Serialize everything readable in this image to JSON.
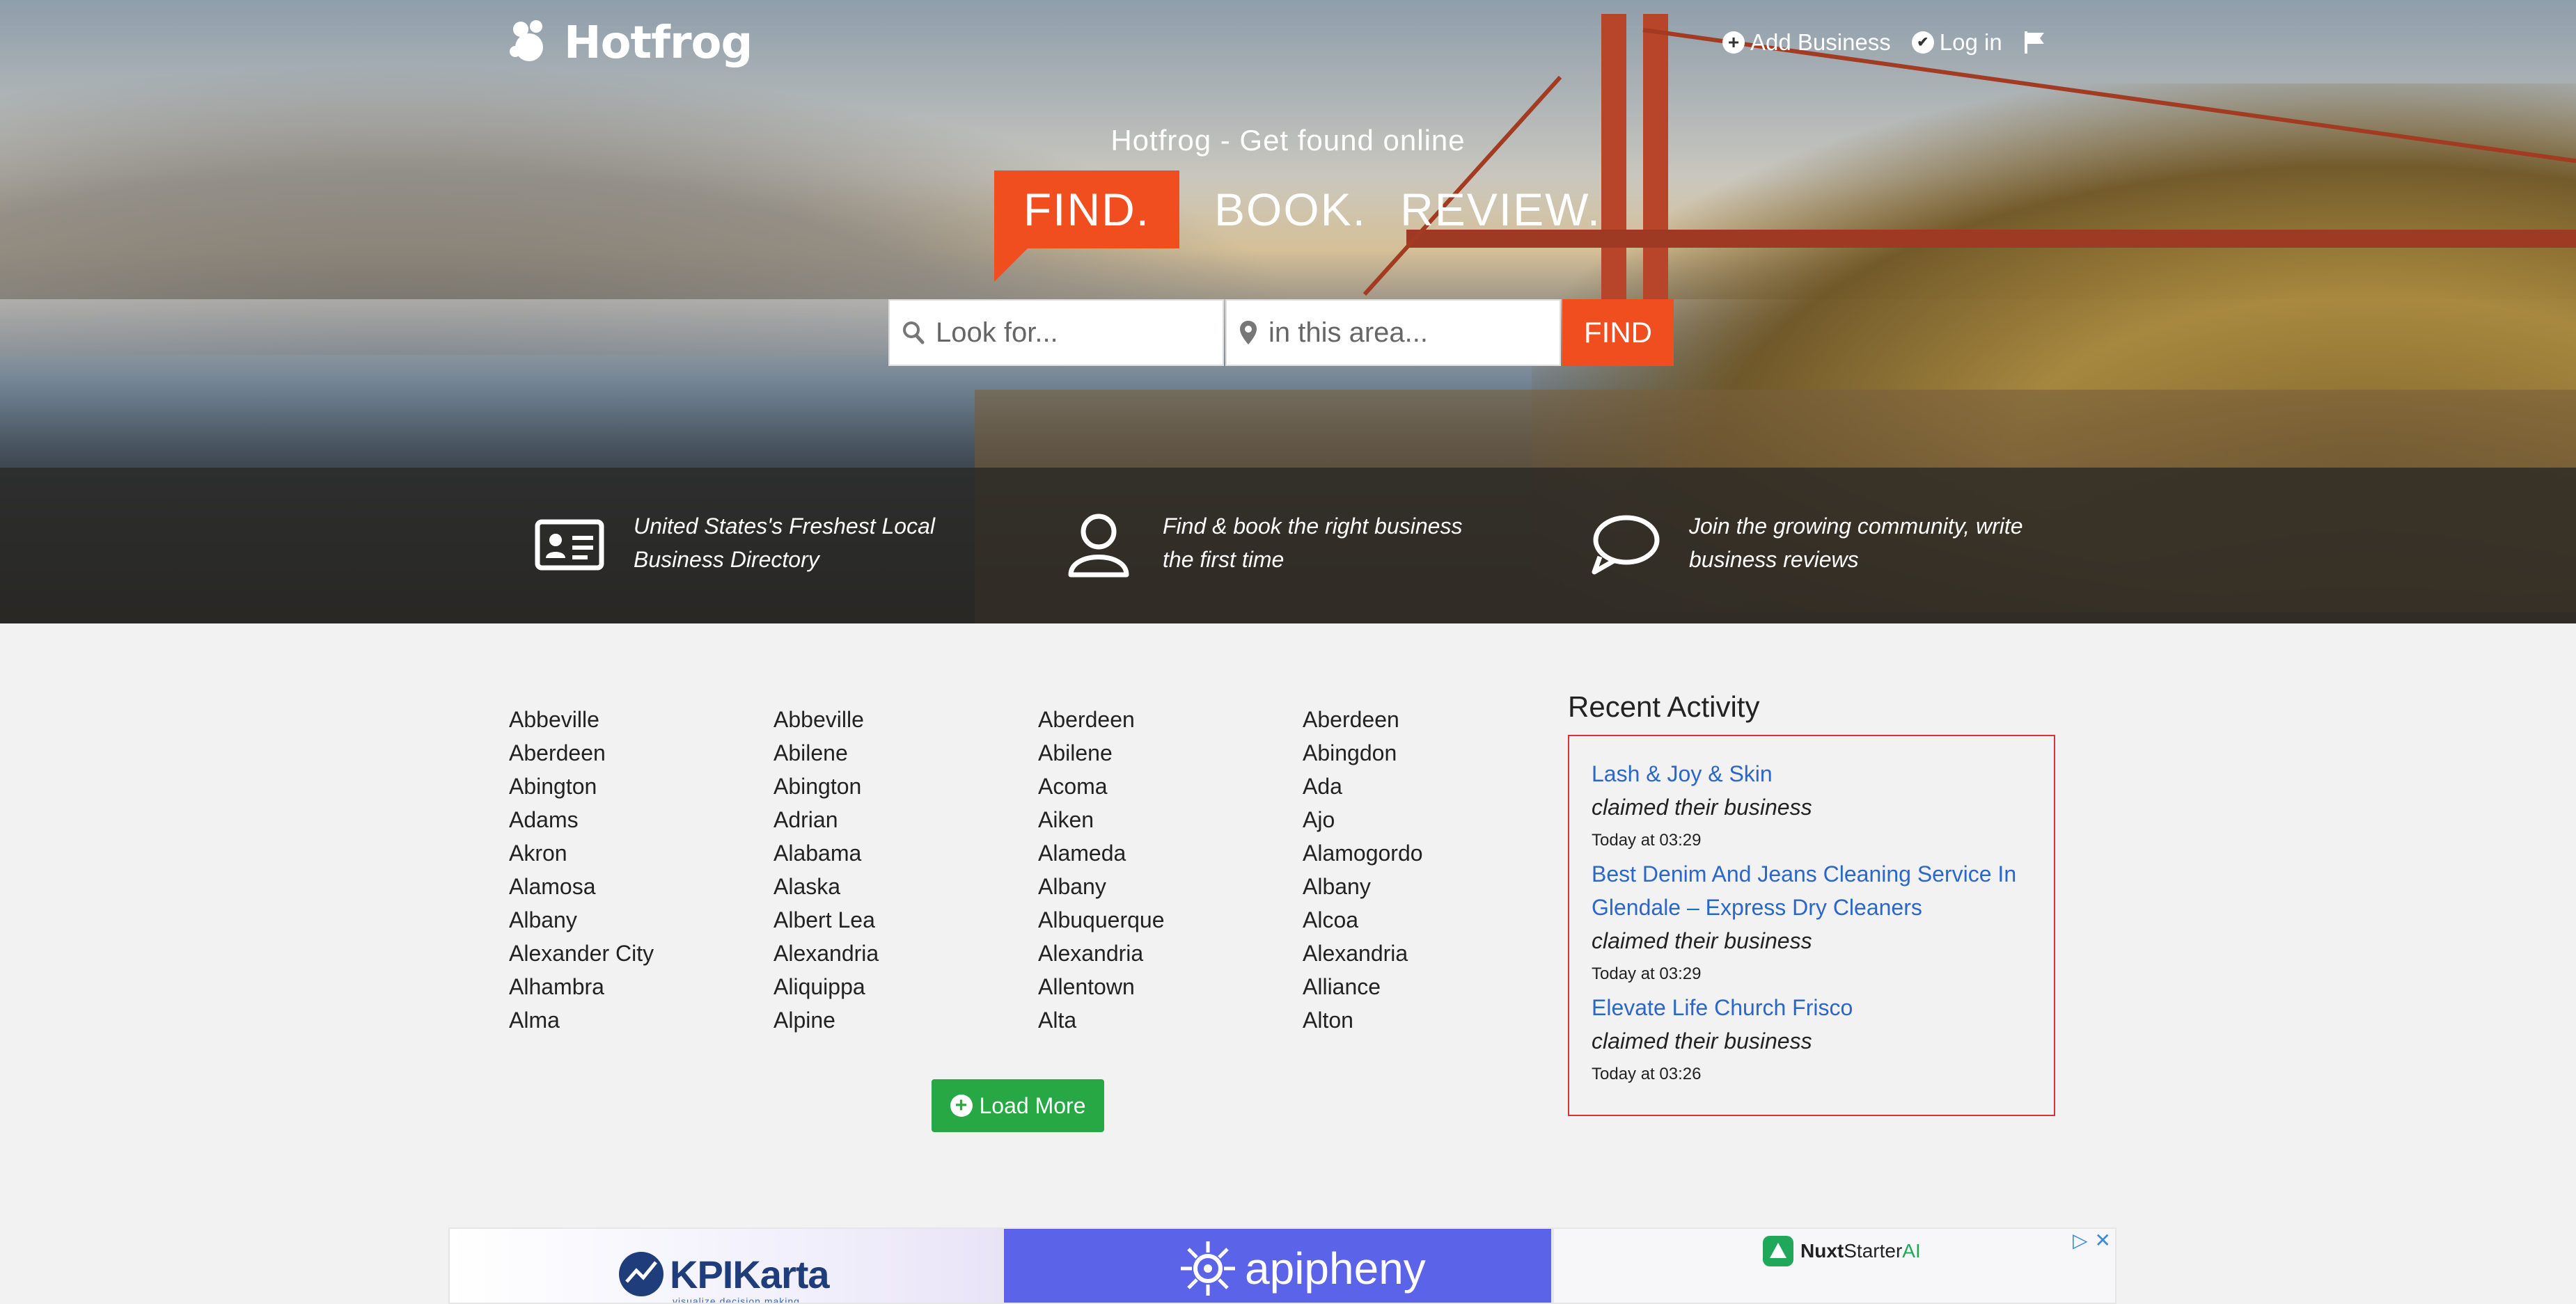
{
  "brand": {
    "name": "Hotfrog"
  },
  "nav": {
    "add_business": "Add Business",
    "login": "Log in"
  },
  "hero": {
    "tagline": "Hotfrog - Get found online",
    "slogan": {
      "find": "FIND.",
      "book": "BOOK.",
      "review": "REVIEW."
    },
    "search": {
      "what_placeholder": "Look for...",
      "where_placeholder": "in this area...",
      "button": "FIND"
    }
  },
  "features": [
    {
      "icon": "id-card-icon",
      "text": "United States's Freshest Local Business Directory"
    },
    {
      "icon": "user-icon",
      "text": "Find & book the right business the first time"
    },
    {
      "icon": "speech-bubble-icon",
      "text": "Join the growing community, write business reviews"
    }
  ],
  "cities": {
    "columns": [
      [
        "Abbeville",
        "Aberdeen",
        "Abington",
        "Adams",
        "Akron",
        "Alamosa",
        "Albany",
        "Alexander City",
        "Alhambra",
        "Alma"
      ],
      [
        "Abbeville",
        "Abilene",
        "Abington",
        "Adrian",
        "Alabama",
        "Alaska",
        "Albert Lea",
        "Alexandria",
        "Aliquippa",
        "Alpine"
      ],
      [
        "Aberdeen",
        "Abilene",
        "Acoma",
        "Aiken",
        "Alameda",
        "Albany",
        "Albuquerque",
        "Alexandria",
        "Allentown",
        "Alta"
      ],
      [
        "Aberdeen",
        "Abingdon",
        "Ada",
        "Ajo",
        "Alamogordo",
        "Albany",
        "Alcoa",
        "Alexandria",
        "Alliance",
        "Alton"
      ]
    ],
    "load_more": "Load More"
  },
  "recent_activity": {
    "title": "Recent Activity",
    "items": [
      {
        "business": "Lash & Joy & Skin",
        "action": "claimed their business",
        "time": "Today at 03:29"
      },
      {
        "business": "Best Denim And Jeans Cleaning Service In Glendale – Express Dry Cleaners",
        "action": "claimed their business",
        "time": "Today at 03:29"
      },
      {
        "business": "Elevate Life Church Frisco",
        "action": "claimed their business",
        "time": "Today at 03:26"
      }
    ]
  },
  "ads": {
    "ad1": {
      "name": "KPIKarta",
      "tagline": "visualize decision making"
    },
    "ad2": {
      "name": "apipheny"
    },
    "ad3": {
      "name_bold": "Nuxt",
      "name_rest": "Starter",
      "name_ai": "AI"
    }
  },
  "colors": {
    "accent": "#f04e1f",
    "success": "#28a745",
    "link": "#2b66c9",
    "activity_border": "#d9303a"
  }
}
